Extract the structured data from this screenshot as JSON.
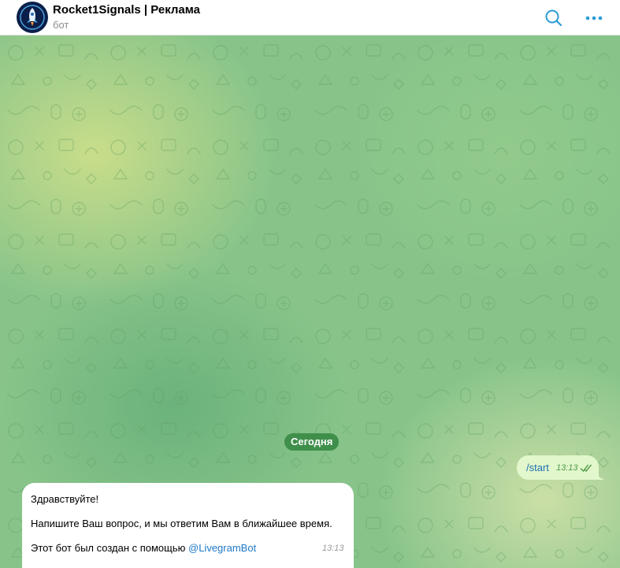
{
  "header": {
    "title": "Rocket1Signals | Реклама",
    "subtitle": "бот",
    "avatar_icon": "rocket-logo-icon",
    "search_icon": "search-icon",
    "more_icon": "more-dots-icon",
    "accent_color": "#2b9bd6"
  },
  "chat": {
    "date_label": "Сегодня",
    "outgoing": {
      "text": "/start",
      "time": "13:13",
      "status_icon": "double-check-icon"
    },
    "incoming": {
      "line1": "Здравствуйте!",
      "line2": "Напишите Ваш вопрос, и мы ответим Вам в ближайшее время.",
      "line3_prefix": "Этот бот был создан с помощью ",
      "mention": "@LivegramBot",
      "time": "13:13"
    },
    "bubble_out_color": "#e2f7cb",
    "bubble_in_color": "#ffffff"
  }
}
